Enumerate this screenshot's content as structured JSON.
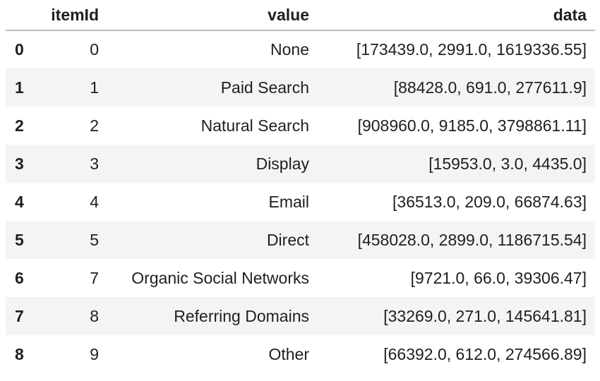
{
  "table": {
    "columns": [
      "",
      "itemId",
      "value",
      "data"
    ],
    "rows": [
      {
        "index": "0",
        "itemId": "0",
        "value": "None",
        "data": "[173439.0, 2991.0, 1619336.55]"
      },
      {
        "index": "1",
        "itemId": "1",
        "value": "Paid Search",
        "data": "[88428.0, 691.0, 277611.9]"
      },
      {
        "index": "2",
        "itemId": "2",
        "value": "Natural Search",
        "data": "[908960.0, 9185.0, 3798861.11]"
      },
      {
        "index": "3",
        "itemId": "3",
        "value": "Display",
        "data": "[15953.0, 3.0, 4435.0]"
      },
      {
        "index": "4",
        "itemId": "4",
        "value": "Email",
        "data": "[36513.0, 209.0, 66874.63]"
      },
      {
        "index": "5",
        "itemId": "5",
        "value": "Direct",
        "data": "[458028.0, 2899.0, 1186715.54]"
      },
      {
        "index": "6",
        "itemId": "7",
        "value": "Organic Social Networks",
        "data": "[9721.0, 66.0, 39306.47]"
      },
      {
        "index": "7",
        "itemId": "8",
        "value": "Referring Domains",
        "data": "[33269.0, 271.0, 145641.81]"
      },
      {
        "index": "8",
        "itemId": "9",
        "value": "Other",
        "data": "[66392.0, 612.0, 274566.89]"
      }
    ]
  },
  "colors": {
    "header_border": "#bdbdbd",
    "stripe": "#f4f4f4",
    "text": "#1f1f1f"
  }
}
